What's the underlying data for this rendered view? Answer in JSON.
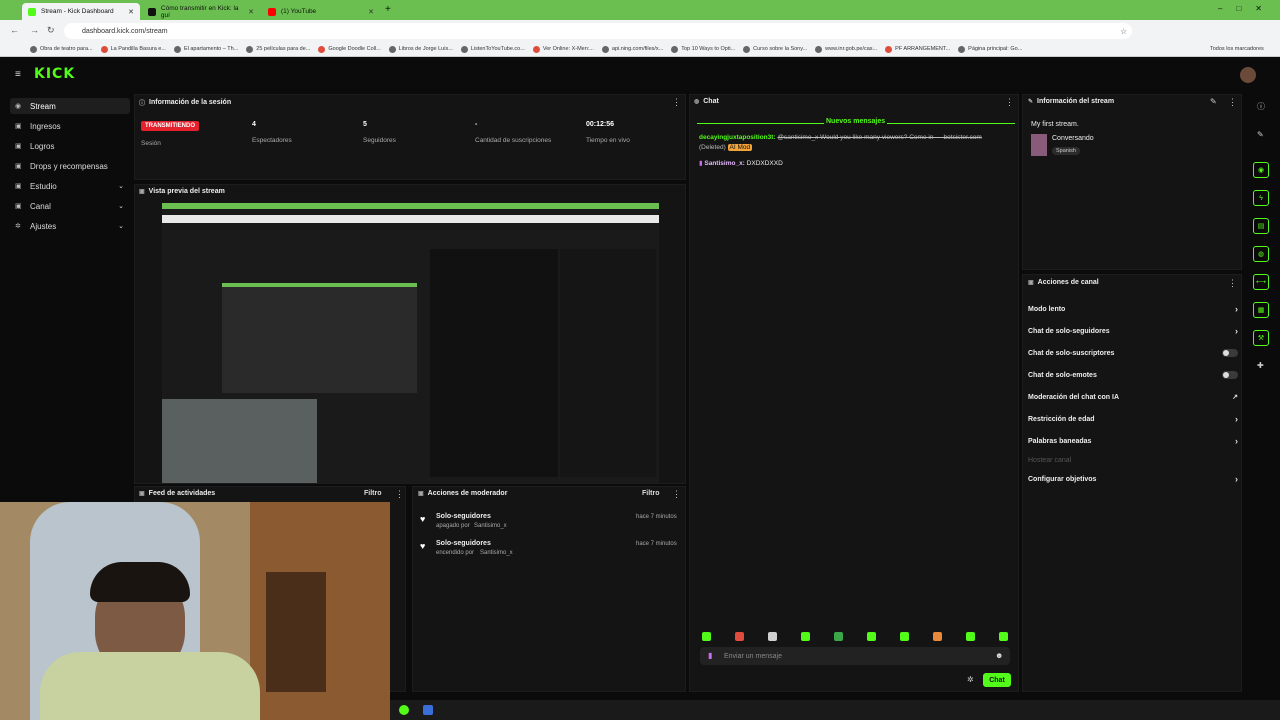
{
  "browser": {
    "tabs": [
      {
        "title": "Stream - Kick Dashboard",
        "color": "#53fc18"
      },
      {
        "title": "Cómo transmitir en Kick: la guí",
        "color": "#111111"
      },
      {
        "title": "(1) YouTube",
        "color": "#ff0000"
      }
    ],
    "url": "dashboard.kick.com/stream",
    "bookmarks": [
      "Obra de teatro para...",
      "La Pandilla Basura e...",
      "El apartamento – Th...",
      "25 películas para de...",
      "Google Doodle Coll...",
      "Libros de Jorge Luis...",
      "ListenToYouTube.co...",
      "Ver Online: X-Men:...",
      "api.ning.com/files/x...",
      "Top 10 Ways to Opti...",
      "Curso sobre la Sony...",
      "www.inr.gob.pe/cas...",
      "PF ARRANGEMENT...",
      "Página principal: Go..."
    ],
    "all_bookmarks": "Todos los marcadores"
  },
  "brand": {
    "logo": "KICK",
    "accent": "#53fc18"
  },
  "sidebar": {
    "items": [
      {
        "label": "Stream",
        "icon": "stream-icon"
      },
      {
        "label": "Ingresos",
        "icon": "money-icon"
      },
      {
        "label": "Logros",
        "icon": "trophy-icon"
      },
      {
        "label": "Drops y recompensas",
        "icon": "gift-icon"
      },
      {
        "label": "Estudio",
        "icon": "studio-icon"
      },
      {
        "label": "Canal",
        "icon": "channel-icon"
      },
      {
        "label": "Ajustes",
        "icon": "gear-icon"
      }
    ]
  },
  "session": {
    "title": "Información de la sesión",
    "live_badge": "TRANSMITIENDO",
    "session_label": "Sesión",
    "stats": [
      {
        "value": "4",
        "label": "Espectadores"
      },
      {
        "value": "5",
        "label": "Seguidores"
      },
      {
        "value": "-",
        "label": "Cantidad de suscripciones"
      },
      {
        "value": "00:12:56",
        "label": "Tiempo en vivo"
      }
    ]
  },
  "preview": {
    "title": "Vista previa del stream"
  },
  "activity": {
    "title": "Feed de actividades",
    "filter": "Filtro"
  },
  "modactions": {
    "title": "Acciones de moderador",
    "filter": "Filtro",
    "items": [
      {
        "title": "Solo-seguidores",
        "action": "apagado por",
        "user": "Santisimo_x",
        "time": "hace 7 minutos"
      },
      {
        "title": "Solo-seguidores",
        "action": "encendido por",
        "user": "Santisimo_x",
        "time": "hace 7 minutos"
      }
    ]
  },
  "chat": {
    "title": "Chat",
    "new_messages": "Nuevos mensajes",
    "messages": [
      {
        "user": "decayingjuxtaposition3t:",
        "text": "@santisimo_x Would you like many viewers? Come in — botsister.com",
        "deleted": "(Deleted)",
        "badge": "AI Mod"
      },
      {
        "user": "Santisimo_x:",
        "text": "DXDXDXXD"
      }
    ],
    "placeholder": "Enviar un mensaje",
    "send": "Chat"
  },
  "streaminfo": {
    "title": "Información del stream",
    "stream_title": "My first stream.",
    "category": "Conversando",
    "language": "Spanish"
  },
  "channel_actions": {
    "title": "Acciones de canal",
    "items": [
      {
        "label": "Modo lento",
        "kind": "chevron"
      },
      {
        "label": "Chat de solo-seguidores",
        "kind": "chevron"
      },
      {
        "label": "Chat de solo-suscriptores",
        "kind": "toggle"
      },
      {
        "label": "Chat de solo-emotes",
        "kind": "toggle"
      },
      {
        "label": "Moderación del chat con IA",
        "kind": "external"
      },
      {
        "label": "Restricción de edad",
        "kind": "chevron"
      },
      {
        "label": "Palabras baneadas",
        "kind": "chevron"
      },
      {
        "label": "Hostear canal",
        "kind": "disabled"
      },
      {
        "label": "Configurar objetivos",
        "kind": "chevron"
      }
    ]
  }
}
